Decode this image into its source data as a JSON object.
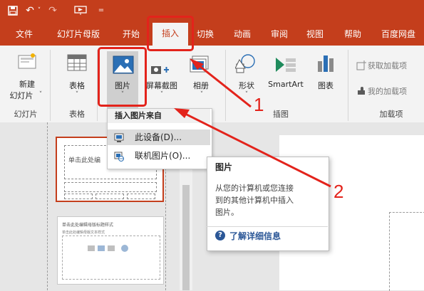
{
  "quick_access": {
    "save_icon": "save-icon",
    "undo_symbol": "↶",
    "undo_arrow": "˅",
    "redo_symbol": "↷",
    "present_icon": "present-icon",
    "customize_symbol": "="
  },
  "tabs": [
    "文件",
    "幻灯片母版",
    "开始",
    "插入",
    "切换",
    "动画",
    "审阅",
    "视图",
    "帮助",
    "百度网盘"
  ],
  "active_tab": "插入",
  "ribbon": {
    "new_slide": {
      "line1": "新建",
      "line2": "幻灯片",
      "arrow": "˅"
    },
    "table": {
      "label": "表格",
      "arrow": "˅"
    },
    "pictures": {
      "label": "图片",
      "arrow": "˅"
    },
    "screenshot": {
      "label": "屏幕截图",
      "arrow": "˅"
    },
    "album": {
      "label": "相册",
      "arrow": "˅"
    },
    "shapes": {
      "label": "形状",
      "arrow": "˅"
    },
    "smartart": {
      "label": "SmartArt"
    },
    "chart": {
      "label": "图表"
    },
    "get_addins": {
      "label": "获取加载项"
    },
    "my_addins": {
      "label": "我的加载项",
      "arrow": "˅"
    },
    "groups": {
      "slides": "幻灯片",
      "tables": "表格",
      "illustrations": "插图",
      "addins": "加载项"
    }
  },
  "dropdown": {
    "header": "插入图片来自",
    "items": [
      {
        "label": "此设备(D)...",
        "icon": "device-icon"
      },
      {
        "label": "联机图片(O)...",
        "icon": "online-picture-icon"
      }
    ]
  },
  "tooltip": {
    "title": "图片",
    "body_lines": [
      "从您的计算机或您连接",
      "到的其他计算机中插入",
      "图片。"
    ],
    "link": "了解详细信息",
    "help_icon": "?"
  },
  "slides": {
    "thumb1_text": "单击此处编",
    "thumb2_title": "单击此处编辑母版标题样式",
    "thumb2_subtitle": "单击此处编辑母版文本样式"
  },
  "annotations": {
    "step1": "1",
    "step2": "2"
  },
  "colors": {
    "accent": "#c43e1c",
    "annotation": "#e3231b"
  }
}
